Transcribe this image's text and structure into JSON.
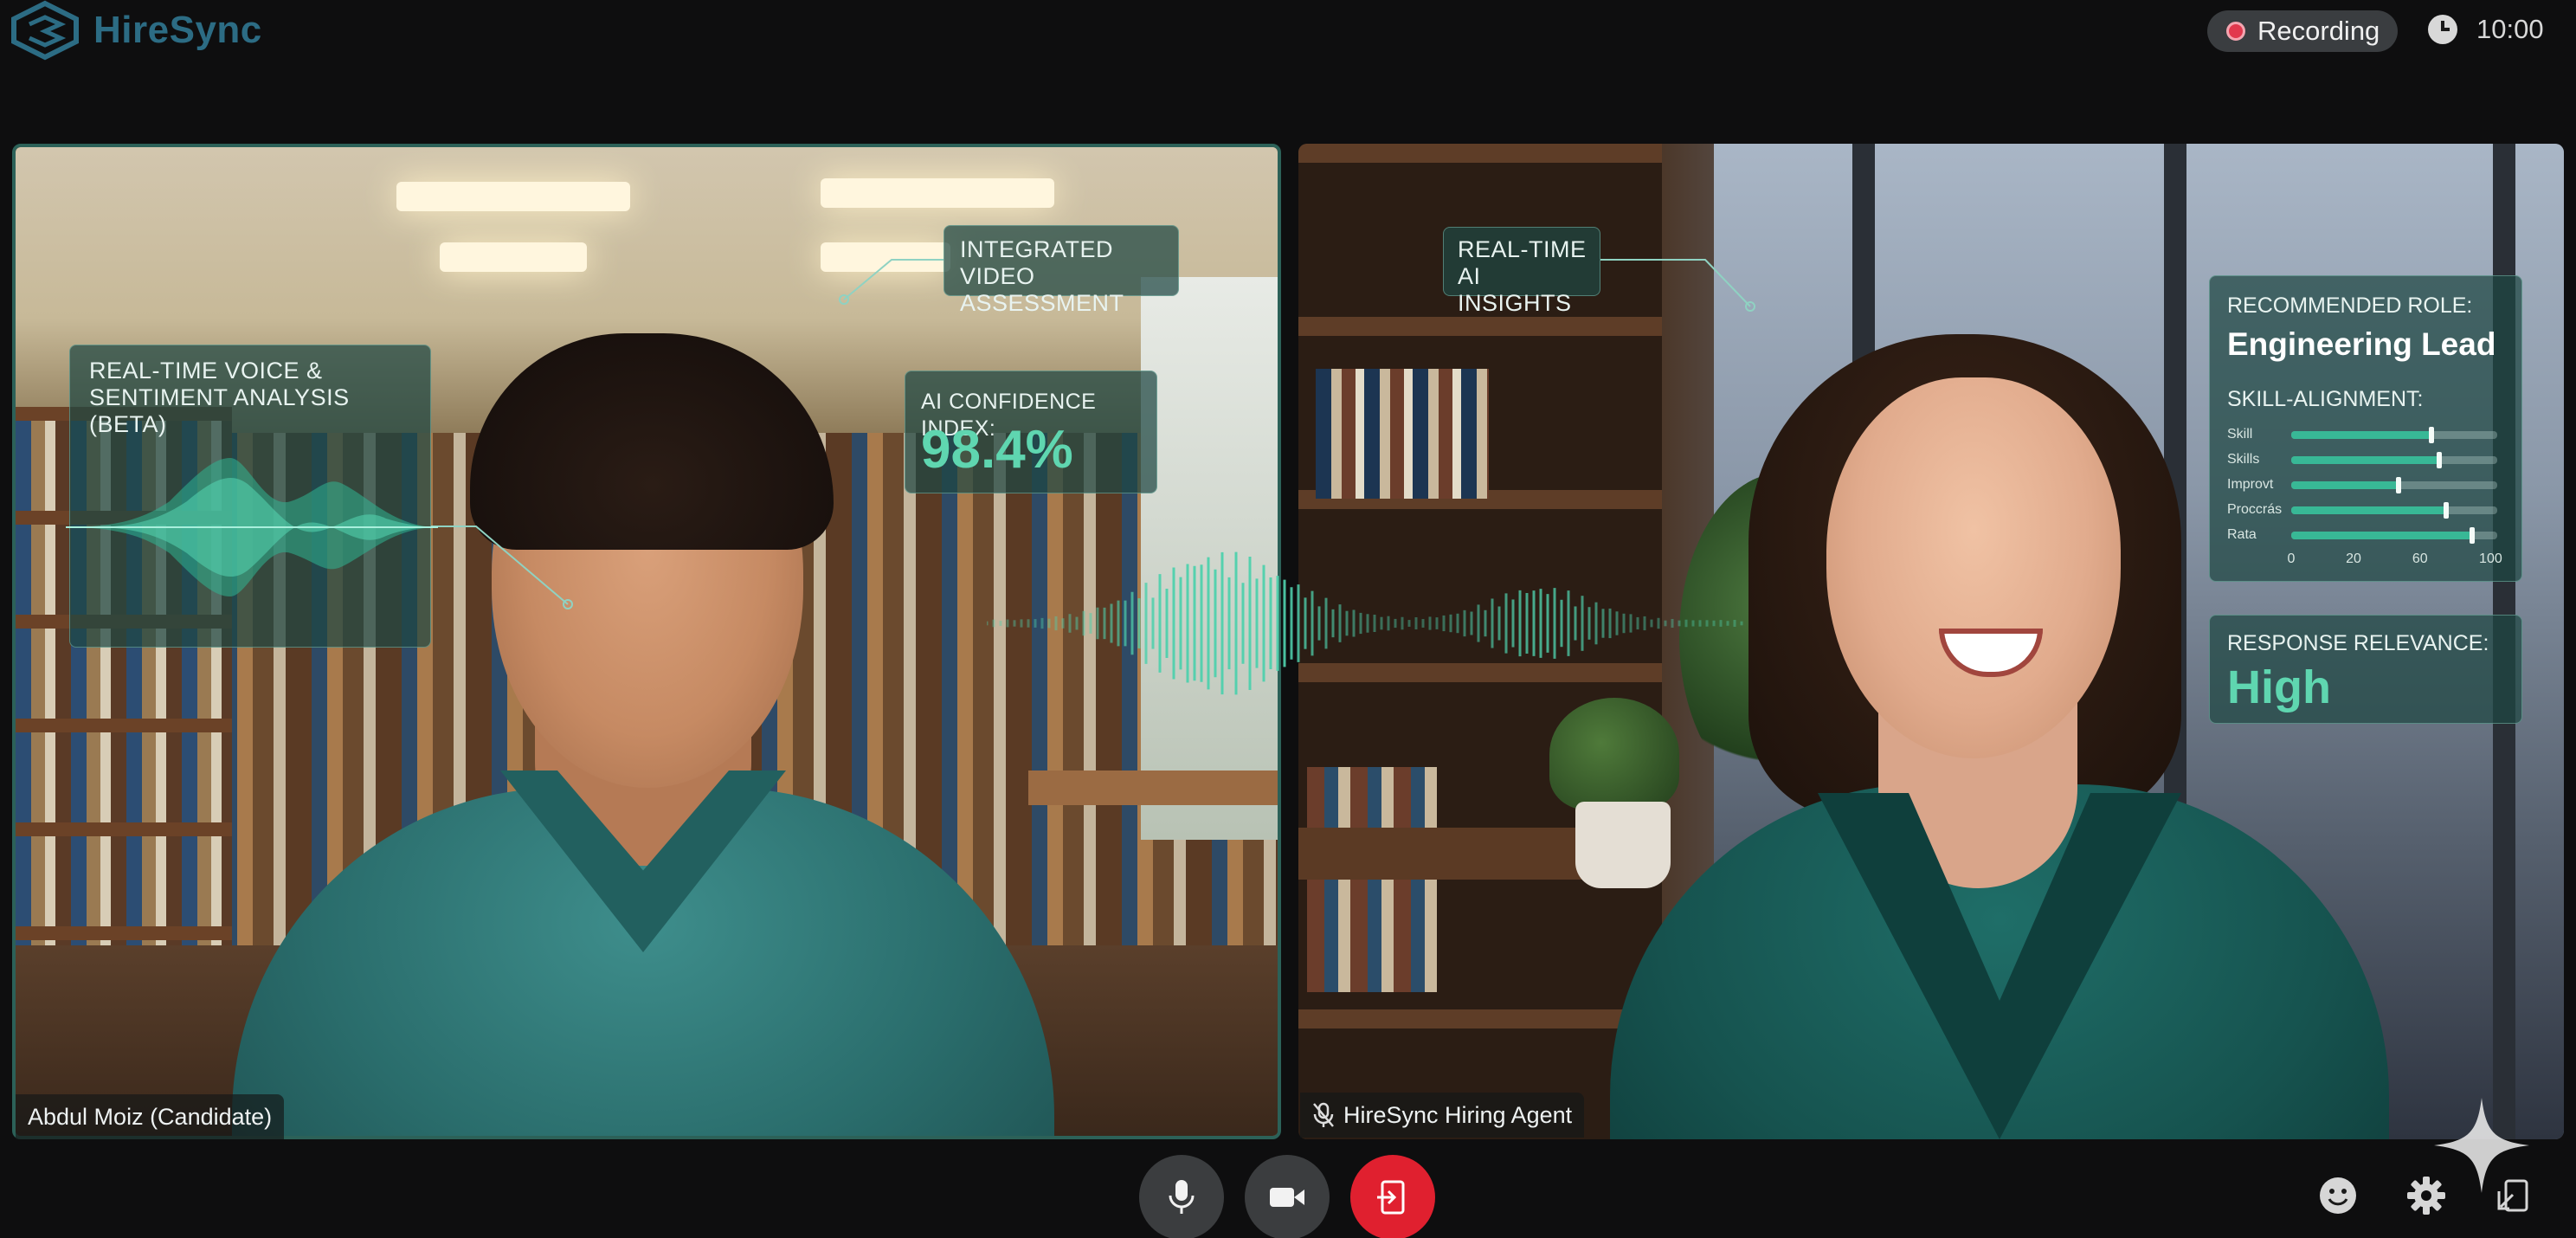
{
  "app": {
    "name": "HireSync",
    "brand_color": "#2c6c84",
    "accent_color": "#5fd6b0"
  },
  "header": {
    "recording_label": "Recording",
    "recording_color": "#e2384d",
    "time": "10:00"
  },
  "tiles": {
    "candidate": {
      "name": "Abdul Moiz (Candidate)"
    },
    "agent": {
      "name": "HireSync Hiring Agent"
    }
  },
  "overlays": {
    "voice_title": "REAL-TIME VOICE & SENTIMENT ANALYSIS (BETA)",
    "video_title": "INTEGRATED VIDEO ASSESSMENT",
    "confidence_title": "AI CONFIDENCE INDEX:",
    "confidence_value": "98.4%",
    "insights_title": "REAL-TIME AI INSIGHTS",
    "role_title": "RECOMMENDED ROLE:",
    "role_value": "Engineering Lead",
    "skill_title": "SKILL-ALIGNMENT:",
    "skills": [
      {
        "label": "Skill",
        "value": 68
      },
      {
        "label": "Skills",
        "value": 72
      },
      {
        "label": "Improvt",
        "value": 52
      },
      {
        "label": "Proccrás",
        "value": 75
      },
      {
        "label": "Rata",
        "value": 88
      }
    ],
    "skill_ticks": [
      "0",
      "20",
      "60",
      "100"
    ],
    "relevance_title": "RESPONSE RELEVANCE:",
    "relevance_value": "High"
  },
  "controls": {
    "mic": "microphone-icon",
    "camera": "video-camera-icon",
    "leave": "leave-call-icon",
    "leave_color": "#e0202f",
    "emoji": "emoji-icon",
    "settings": "gear-icon",
    "screen": "screen-share-icon"
  }
}
